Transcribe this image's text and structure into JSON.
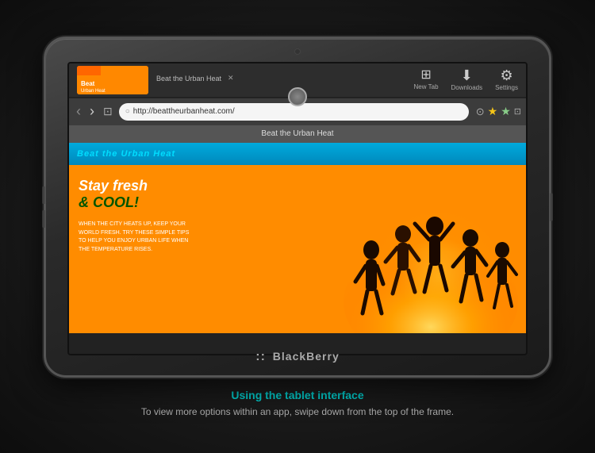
{
  "device": {
    "brand": "BlackBerry",
    "logo_symbol": ":::"
  },
  "browser": {
    "tab_label": "Beat the Urban Heat",
    "tab_close": "✕",
    "menu_items": [
      {
        "icon": "⊞",
        "label": "New Tab"
      },
      {
        "icon": "⬇",
        "label": "Downloads"
      },
      {
        "icon": "⚙",
        "label": "Settings"
      }
    ],
    "nav_back": "‹",
    "nav_forward": "›",
    "nav_window": "⊡",
    "address_icon": "○",
    "address_url": "http://beattheurbanheat.com/",
    "history_icon": "⊙",
    "star_gold_icon": "★",
    "star_gray_icon": "★",
    "share_icon": "⊡",
    "title": "Beat the Urban Heat"
  },
  "website": {
    "header_text": "Beat the Urban Heat",
    "tagline1": "Stay fresh",
    "tagline2": "& COOL!",
    "body_text": "WHEN THE CITY HEATS UP, KEEP YOUR WORLD FRESH. TRY THESE SIMPLE TIPS TO HELP YOU ENJOY URBAN LIFE WHEN THE TEMPERATURE RISES."
  },
  "caption": {
    "title": "Using the tablet interface",
    "description": "To view more options within an app, swipe down from the top of the frame."
  }
}
